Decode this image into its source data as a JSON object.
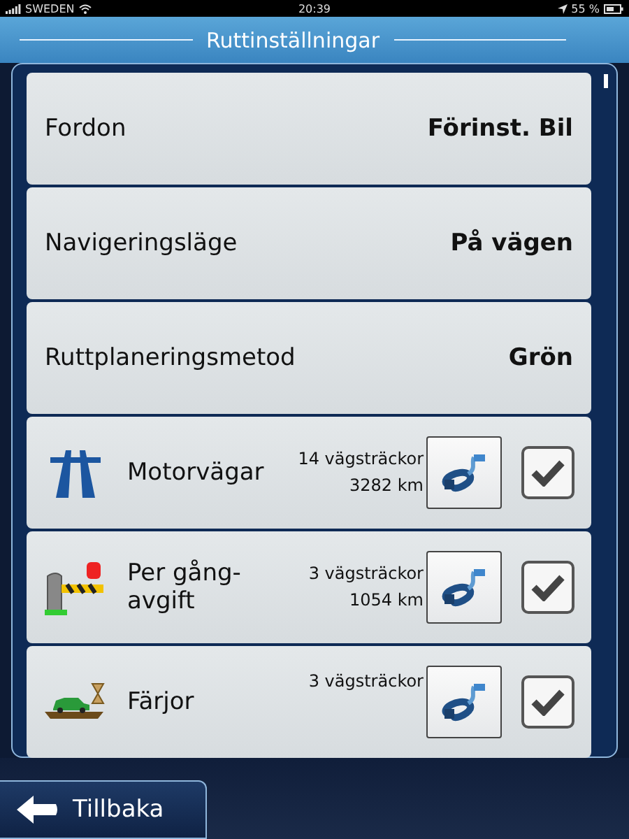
{
  "status_bar": {
    "carrier": "SWEDEN",
    "time": "20:39",
    "battery": "55 %"
  },
  "title": "Ruttinställningar",
  "settings": [
    {
      "label": "Fordon",
      "value": "Förinst. Bil"
    },
    {
      "label": "Navigeringsläge",
      "value": "På vägen"
    },
    {
      "label": "Ruttplaneringsmetod",
      "value": "Grön"
    }
  ],
  "road_types": [
    {
      "kind": "motorway",
      "label": "Motorvägar",
      "segments": "14 vägsträckor",
      "distance": "3282 km",
      "checked": true
    },
    {
      "kind": "toll",
      "label": "Per gång-avgift",
      "segments": "3 vägsträckor",
      "distance": "1054 km",
      "checked": true
    },
    {
      "kind": "ferry",
      "label": "Färjor",
      "segments": "3 vägsträckor",
      "checked": true
    }
  ],
  "back_button": "Tillbaka"
}
